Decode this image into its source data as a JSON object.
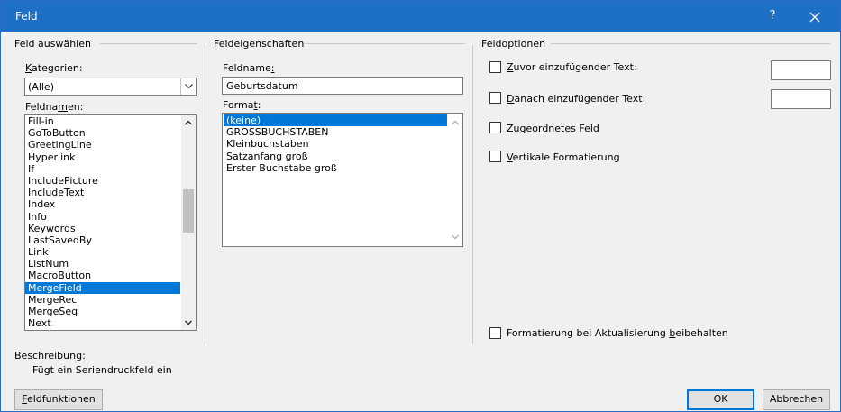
{
  "window": {
    "title": "Feld",
    "help": "?"
  },
  "left": {
    "group_title": "Feld auswählen",
    "categories_label_acc": "K",
    "categories_label_rest": "ategorien:",
    "categories_value": "(Alle)",
    "fieldnames_label_pre": "Feldna",
    "fieldnames_label_acc": "m",
    "fieldnames_label_post": "en:",
    "fieldnames": [
      "Fill-in",
      "GoToButton",
      "GreetingLine",
      "Hyperlink",
      "If",
      "IncludePicture",
      "IncludeText",
      "Index",
      "Info",
      "Keywords",
      "LastSavedBy",
      "Link",
      "ListNum",
      "MacroButton",
      "MergeField",
      "MergeRec",
      "MergeSeq",
      "Next"
    ],
    "selected_fieldname": "MergeField"
  },
  "middle": {
    "group_title": "Feldeigenschaften",
    "name_label_pre": "Feldname",
    "name_label_acc": ":",
    "name_value": "Geburtsdatum",
    "format_label_pre": "Forma",
    "format_label_acc": "t",
    "format_label_post": ":",
    "formats": [
      "(keine)",
      "GROSSBUCHSTABEN",
      "Kleinbuchstaben",
      "Satzanfang groß",
      "Erster Buchstabe groß"
    ],
    "selected_format": "(keine)"
  },
  "right": {
    "group_title": "Feldoptionen",
    "opt_before_acc": "Z",
    "opt_before_rest": "uvor einzufügender Text:",
    "opt_after_acc": "D",
    "opt_after_rest": "anach einzufügender Text:",
    "opt_mapped_acc": "Z",
    "opt_mapped_rest": "ugeordnetes Feld",
    "opt_vertical_acc": "V",
    "opt_vertical_rest": "ertikale Formatierung",
    "keep_format_pre": "Formatierung bei Aktualisierung ",
    "keep_format_acc": "b",
    "keep_format_post": "eibehalten"
  },
  "description": {
    "label": "Beschreibung:",
    "text": "Fügt ein Seriendruckfeld ein"
  },
  "buttons": {
    "field_codes_acc": "F",
    "field_codes_rest": "eldfunktionen",
    "ok": "OK",
    "cancel": "Abbrechen"
  }
}
